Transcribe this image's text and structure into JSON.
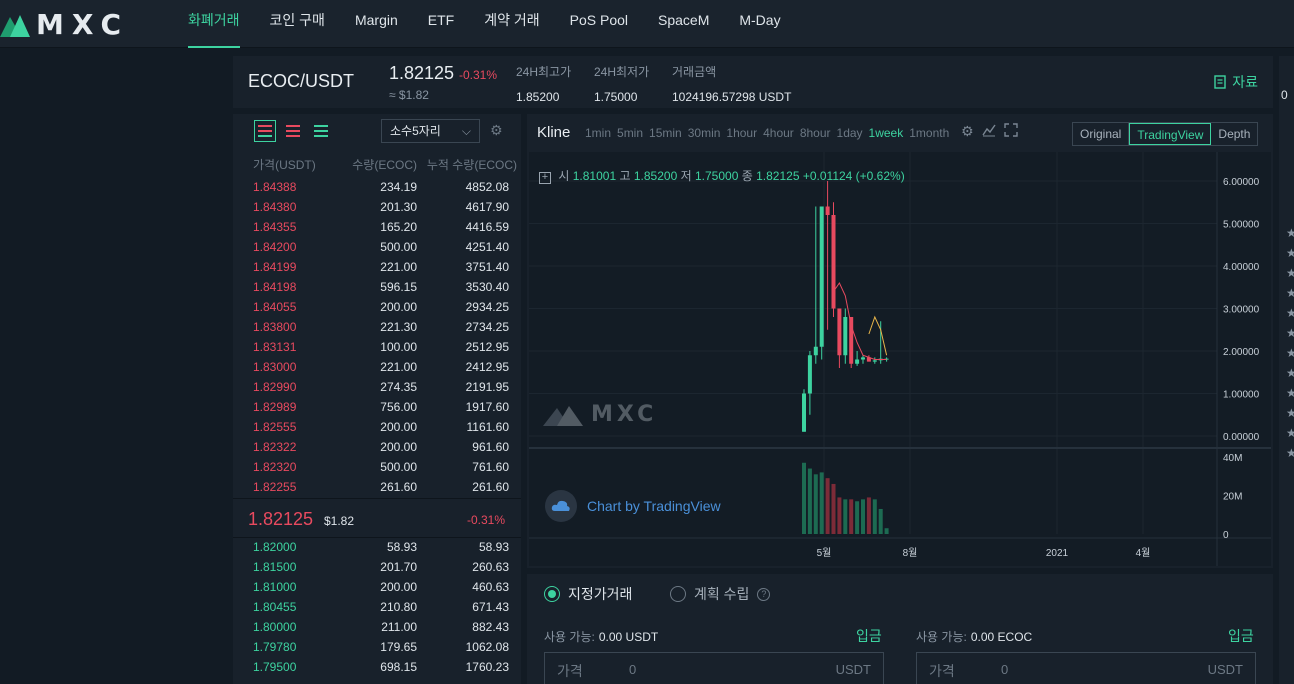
{
  "nav": {
    "logo": "MXC",
    "items": [
      "화폐거래",
      "코인 구매",
      "Margin",
      "ETF",
      "계약 거래",
      "PoS Pool",
      "SpaceM",
      "M-Day"
    ],
    "active_index": 0
  },
  "ticker": {
    "pair": "ECOC/USDT",
    "price": "1.82125",
    "change": "-0.31%",
    "usd": "≈ $1.82",
    "high_label": "24H최고가",
    "high": "1.85200",
    "low_label": "24H최저가",
    "low": "1.75000",
    "volume_label": "거래금액",
    "volume": "1024196.57298 USDT",
    "info_link": "자료"
  },
  "orderbook": {
    "precision": "소수5자리",
    "headers": {
      "price": "가격(USDT)",
      "qty": "수량(ECOC)",
      "cum": "누적 수량(ECOC)"
    },
    "asks": [
      [
        "1.84388",
        "234.19",
        "4852.08"
      ],
      [
        "1.84380",
        "201.30",
        "4617.90"
      ],
      [
        "1.84355",
        "165.20",
        "4416.59"
      ],
      [
        "1.84200",
        "500.00",
        "4251.40"
      ],
      [
        "1.84199",
        "221.00",
        "3751.40"
      ],
      [
        "1.84198",
        "596.15",
        "3530.40"
      ],
      [
        "1.84055",
        "200.00",
        "2934.25"
      ],
      [
        "1.83800",
        "221.30",
        "2734.25"
      ],
      [
        "1.83131",
        "100.00",
        "2512.95"
      ],
      [
        "1.83000",
        "221.00",
        "2412.95"
      ],
      [
        "1.82990",
        "274.35",
        "2191.95"
      ],
      [
        "1.82989",
        "756.00",
        "1917.60"
      ],
      [
        "1.82555",
        "200.00",
        "1161.60"
      ],
      [
        "1.82322",
        "200.00",
        "961.60"
      ],
      [
        "1.82320",
        "500.00",
        "761.60"
      ],
      [
        "1.82255",
        "261.60",
        "261.60"
      ]
    ],
    "mid": {
      "price": "1.82125",
      "usd": "$1.82",
      "change": "-0.31%"
    },
    "bids": [
      [
        "1.82000",
        "58.93",
        "58.93"
      ],
      [
        "1.81500",
        "201.70",
        "260.63"
      ],
      [
        "1.81000",
        "200.00",
        "460.63"
      ],
      [
        "1.80455",
        "210.80",
        "671.43"
      ],
      [
        "1.80000",
        "211.00",
        "882.43"
      ],
      [
        "1.79780",
        "179.65",
        "1062.08"
      ],
      [
        "1.79500",
        "698.15",
        "1760.23"
      ]
    ]
  },
  "chart": {
    "title": "Kline",
    "intervals": [
      "1min",
      "5min",
      "15min",
      "30min",
      "1hour",
      "4hour",
      "8hour",
      "1day",
      "1week",
      "1month"
    ],
    "active_interval": "1week",
    "views": [
      "Original",
      "TradingView",
      "Depth"
    ],
    "active_view": "TradingView",
    "ohlc": {
      "o_label": "시",
      "o": "1.81001",
      "h_label": "고",
      "h": "1.85200",
      "l_label": "저",
      "l": "1.75000",
      "c_label": "종",
      "c": "1.82125",
      "chg": "+0.01124 (+0.62%)"
    },
    "credit": "Chart by TradingView",
    "watermark": "MXC",
    "colors": {
      "up": "#3dd3a0",
      "down": "#e84a5f",
      "ma": "#e84a5f",
      "ma2": "#e8b54a"
    }
  },
  "chart_data": {
    "type": "candlestick",
    "price_axis": [
      "6.00000",
      "5.00000",
      "4.00000",
      "3.00000",
      "2.00000",
      "1.00000",
      "0.00000"
    ],
    "ylim": [
      0,
      6
    ],
    "volume_axis": [
      "40M",
      "20M",
      "0"
    ],
    "volume_ylim": [
      0,
      40
    ],
    "time_axis": [
      "5월",
      "8월",
      "2021",
      "4월"
    ],
    "candles": [
      {
        "o": 0.1,
        "h": 1.1,
        "l": 0.1,
        "c": 1.0
      },
      {
        "o": 1.0,
        "h": 2.0,
        "l": 0.5,
        "c": 1.9
      },
      {
        "o": 1.9,
        "h": 5.4,
        "l": 1.7,
        "c": 2.1
      },
      {
        "o": 2.1,
        "h": 5.4,
        "l": 1.8,
        "c": 5.4
      },
      {
        "o": 5.4,
        "h": 6.0,
        "l": 2.5,
        "c": 5.2
      },
      {
        "o": 5.2,
        "h": 5.5,
        "l": 2.8,
        "c": 3.0
      },
      {
        "o": 3.0,
        "h": 3.0,
        "l": 1.6,
        "c": 1.9
      },
      {
        "o": 1.9,
        "h": 3.0,
        "l": 1.7,
        "c": 2.8
      },
      {
        "o": 2.8,
        "h": 2.8,
        "l": 1.6,
        "c": 1.7
      },
      {
        "o": 1.7,
        "h": 2.0,
        "l": 1.65,
        "c": 1.8
      },
      {
        "o": 1.8,
        "h": 1.9,
        "l": 1.7,
        "c": 1.85
      },
      {
        "o": 1.85,
        "h": 1.9,
        "l": 1.75,
        "c": 1.75
      },
      {
        "o": 1.75,
        "h": 1.85,
        "l": 1.7,
        "c": 1.78
      },
      {
        "o": 1.78,
        "h": 2.7,
        "l": 1.7,
        "c": 1.82
      },
      {
        "o": 1.82,
        "h": 1.85,
        "l": 1.75,
        "c": 1.82
      }
    ],
    "volumes": [
      37,
      34,
      31,
      32,
      29,
      26,
      19,
      18,
      18,
      17,
      18,
      19,
      18,
      13,
      3
    ],
    "ma": [
      null,
      null,
      null,
      null,
      null,
      3.4,
      3.6,
      3.3,
      2.6,
      2.2,
      1.9,
      1.85,
      1.8,
      1.8,
      1.8
    ],
    "ma2": [
      null,
      null,
      null,
      null,
      null,
      null,
      null,
      null,
      null,
      null,
      null,
      2.4,
      2.8,
      2.5,
      1.9
    ]
  },
  "orderform": {
    "modes": [
      "지정가거래",
      "계획 수립"
    ],
    "active_mode": 0,
    "buy": {
      "avail_label": "사용 가능:",
      "avail": "0.00 USDT",
      "deposit": "입금",
      "field_label": "가격",
      "value": "0",
      "unit": "USDT"
    },
    "sell": {
      "avail_label": "사용 가능:",
      "avail": "0.00 ECOC",
      "deposit": "입금",
      "field_label": "가격",
      "value": "0",
      "unit": "USDT"
    }
  },
  "rightpanel": {
    "partial_top": "0"
  }
}
